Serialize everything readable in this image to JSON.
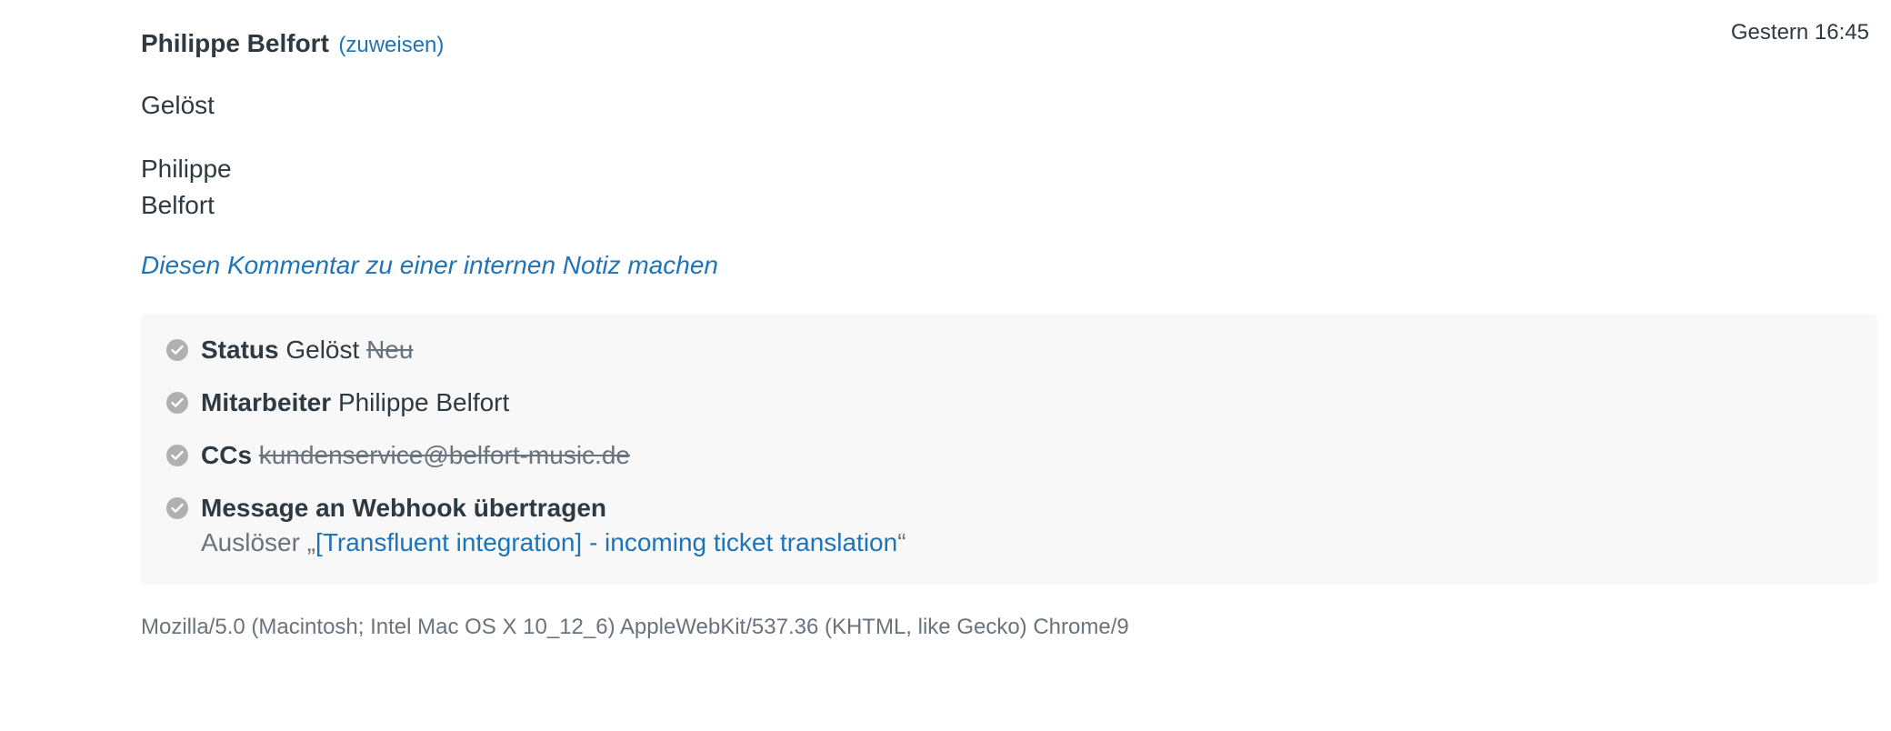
{
  "comment": {
    "author": "Philippe Belfort",
    "assign_label": "(zuweisen)",
    "timestamp": "Gestern 16:45",
    "body_status": "Gelöst",
    "signature_first": "Philippe",
    "signature_last": "Belfort",
    "internal_note_link": "Diesen Kommentar zu einer internen Notiz machen"
  },
  "audit": {
    "status": {
      "label": "Status",
      "new_value": "Gelöst",
      "old_value": "Neu",
      "icon": "check-circle-icon"
    },
    "assignee": {
      "label": "Mitarbeiter",
      "value": "Philippe Belfort",
      "icon": "check-circle-icon"
    },
    "ccs": {
      "label": "CCs",
      "old_value": "kundenservice@belfort-music.de",
      "icon": "check-circle-icon"
    },
    "webhook": {
      "label": "Message an Webhook übertragen",
      "trigger_prefix": "Auslöser „",
      "trigger_name": "[Transfluent integration] - incoming ticket translation",
      "trigger_suffix": "“",
      "icon": "check-circle-icon"
    }
  },
  "user_agent": "Mozilla/5.0 (Macintosh; Intel Mac OS X 10_12_6) AppleWebKit/537.36 (KHTML, like Gecko) Chrome/9",
  "colors": {
    "link": "#1f73b7",
    "text": "#2f3941",
    "muted": "#68737d",
    "audit_bg": "#f8f8f8",
    "check": "#b0b0b0"
  }
}
